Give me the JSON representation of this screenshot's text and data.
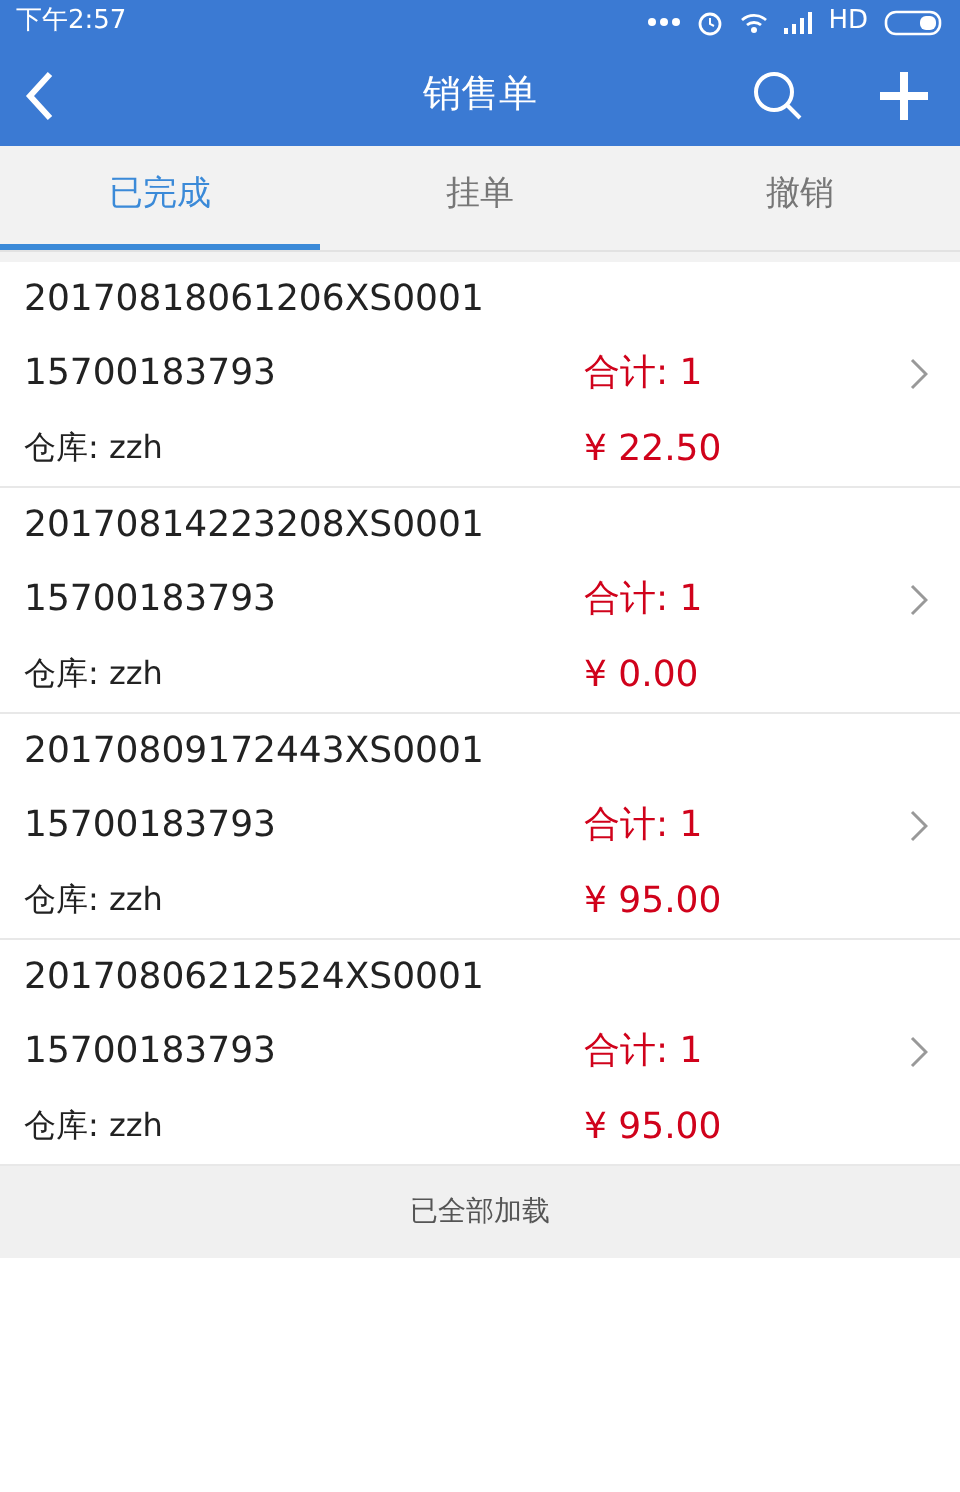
{
  "status_bar": {
    "time": "下午2:57",
    "network": "HD"
  },
  "header": {
    "title": "销售单"
  },
  "tabs": [
    {
      "label": "已完成",
      "selected": true
    },
    {
      "label": "挂单",
      "selected": false
    },
    {
      "label": "撤销",
      "selected": false
    }
  ],
  "orders": [
    {
      "number": "20170818061206XS0001",
      "phone": "15700183793",
      "total": "合计: 1",
      "warehouse": "仓库: zzh",
      "amount": "¥ 22.50"
    },
    {
      "number": "20170814223208XS0001",
      "phone": "15700183793",
      "total": "合计: 1",
      "warehouse": "仓库: zzh",
      "amount": "¥ 0.00"
    },
    {
      "number": "20170809172443XS0001",
      "phone": "15700183793",
      "total": "合计: 1",
      "warehouse": "仓库: zzh",
      "amount": "¥ 95.00"
    },
    {
      "number": "20170806212524XS0001",
      "phone": "15700183793",
      "total": "合计: 1",
      "warehouse": "仓库: zzh",
      "amount": "¥ 95.00"
    }
  ],
  "footer": {
    "text": "已全部加载"
  }
}
